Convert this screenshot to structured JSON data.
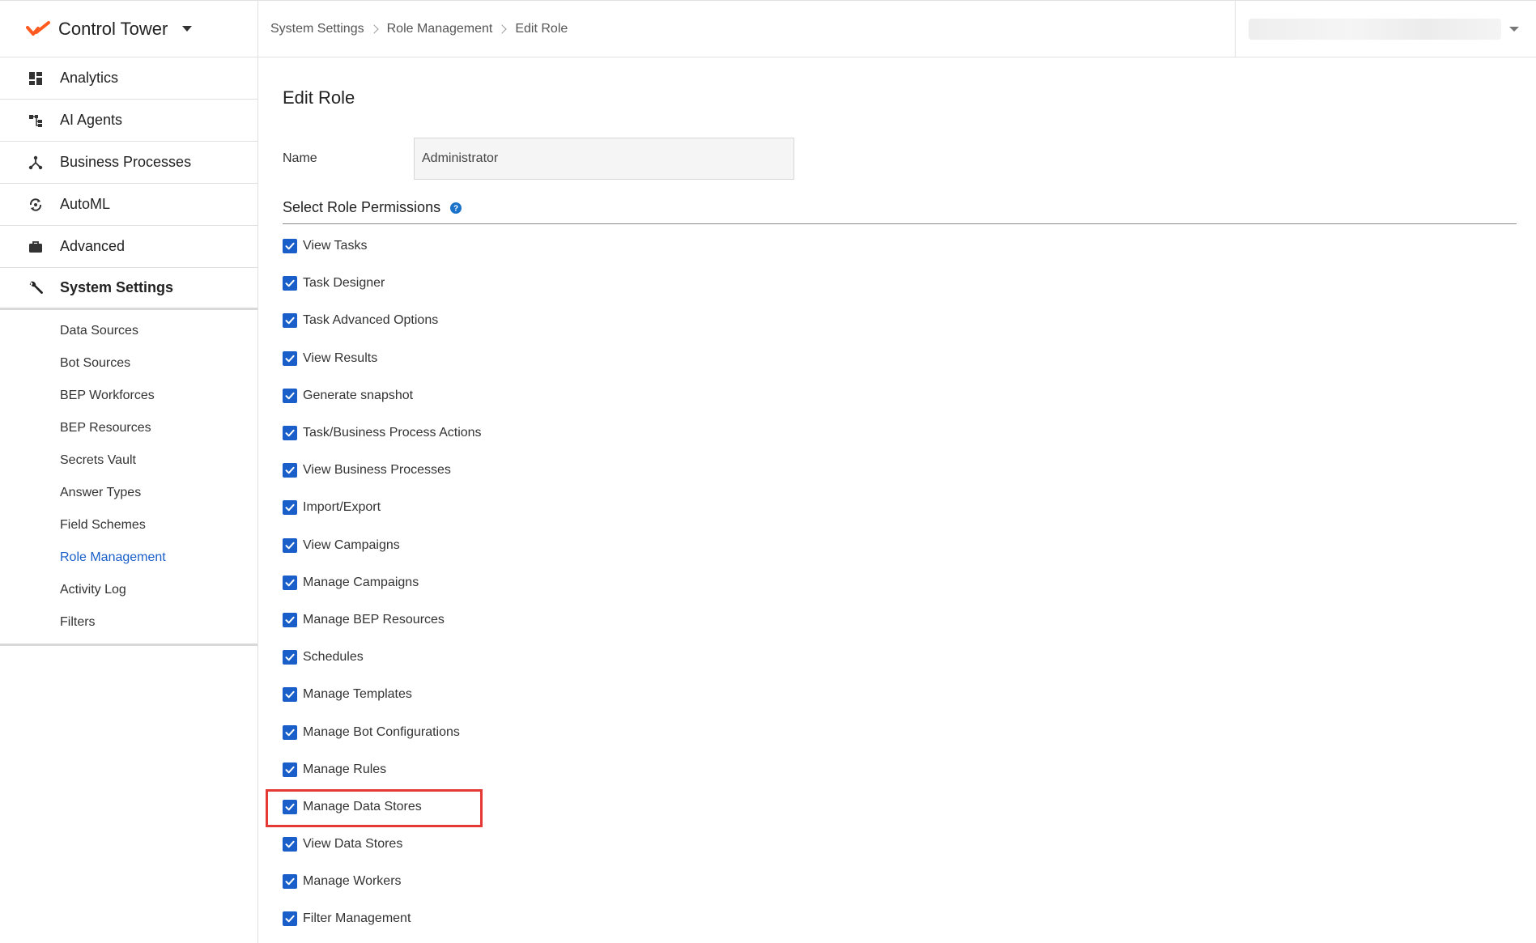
{
  "app": {
    "name": "Control Tower",
    "accent_color": "#1a5fc9",
    "logo_color": "#ff5a1f"
  },
  "sidebar": {
    "items": [
      {
        "label": "Analytics",
        "icon": "dashboard-icon"
      },
      {
        "label": "AI Agents",
        "icon": "hierarchy-icon"
      },
      {
        "label": "Business Processes",
        "icon": "branch-icon"
      },
      {
        "label": "AutoML",
        "icon": "refresh-cycle-icon"
      },
      {
        "label": "Advanced",
        "icon": "briefcase-icon"
      },
      {
        "label": "System Settings",
        "icon": "wrench-icon",
        "active": true
      }
    ],
    "subitems": [
      "Data Sources",
      "Bot Sources",
      "BEP Workforces",
      "BEP Resources",
      "Secrets Vault",
      "Answer Types",
      "Field Schemes",
      "Role Management",
      "Activity Log",
      "Filters"
    ],
    "selected_subitem": "Role Management"
  },
  "breadcrumb": [
    "System Settings",
    "Role Management",
    "Edit Role"
  ],
  "page": {
    "title": "Edit Role",
    "name_label": "Name",
    "name_value": "Administrator",
    "permissions_title": "Select Role Permissions"
  },
  "permissions": [
    {
      "label": "View Tasks",
      "checked": true
    },
    {
      "label": "Task Designer",
      "checked": true
    },
    {
      "label": "Task Advanced Options",
      "checked": true
    },
    {
      "label": "View Results",
      "checked": true
    },
    {
      "label": "Generate snapshot",
      "checked": true
    },
    {
      "label": "Task/Business Process Actions",
      "checked": true
    },
    {
      "label": "View Business Processes",
      "checked": true
    },
    {
      "label": "Import/Export",
      "checked": true
    },
    {
      "label": "View Campaigns",
      "checked": true
    },
    {
      "label": "Manage Campaigns",
      "checked": true
    },
    {
      "label": "Manage BEP Resources",
      "checked": true
    },
    {
      "label": "Schedules",
      "checked": true
    },
    {
      "label": "Manage Templates",
      "checked": true
    },
    {
      "label": "Manage Bot Configurations",
      "checked": true
    },
    {
      "label": "Manage Rules",
      "checked": true
    },
    {
      "label": "Manage Data Stores",
      "checked": true,
      "highlighted": true
    },
    {
      "label": "View Data Stores",
      "checked": true
    },
    {
      "label": "Manage Workers",
      "checked": true
    },
    {
      "label": "Filter Management",
      "checked": true
    }
  ]
}
